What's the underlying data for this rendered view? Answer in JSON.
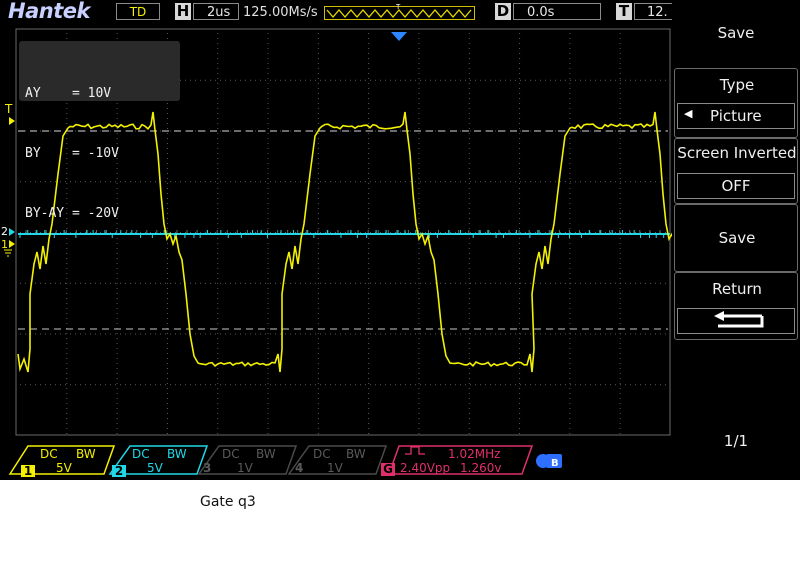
{
  "top_bar": {
    "logo": "Hantek",
    "trigger_mode": "TD",
    "h_key": "H",
    "timebase": "2us",
    "sample_rate": "125.00Ms/s",
    "trigger_marker": "T",
    "d_key": "D",
    "delay": "0.0s",
    "t_key": "T",
    "trigger_level": "12."
  },
  "measurements": {
    "line1": "AY    = 10V",
    "line2": "BY    = -10V",
    "line3": "BY-AY = -20V"
  },
  "markers": {
    "trigger_T": "T",
    "ch2_marker": "2",
    "ch1_marker": "1"
  },
  "menu": {
    "title": "Save",
    "type_label": "Type",
    "type_value": "Picture",
    "screen_inverted_label": "Screen Inverted",
    "screen_inverted_value": "OFF",
    "save_button": "Save",
    "return_label": "Return",
    "page": "1/1"
  },
  "channels": [
    {
      "num": "1",
      "coupling": "DC",
      "bw": "BW",
      "scale": "5V",
      "color": "#f3f000"
    },
    {
      "num": "2",
      "coupling": "DC",
      "bw": "BW",
      "scale": "5V",
      "color": "#20d8e8"
    },
    {
      "num": "3",
      "coupling": "DC",
      "bw": "BW",
      "scale": "1V",
      "color": "#5a5a5a"
    },
    {
      "num": "4",
      "coupling": "DC",
      "bw": "BW",
      "scale": "1V",
      "color": "#5a5a5a"
    }
  ],
  "generator": {
    "label": "G",
    "frequency": "1.02MHz",
    "amplitude": "2.40Vpp",
    "offset": "1.260v",
    "color": "#e0306a"
  },
  "caption": "Gate q3",
  "colors": {
    "ch1": "#f3f000",
    "ch2": "#20d8e8",
    "grid": "#5a5a5a",
    "accent": "#3377ff"
  }
}
